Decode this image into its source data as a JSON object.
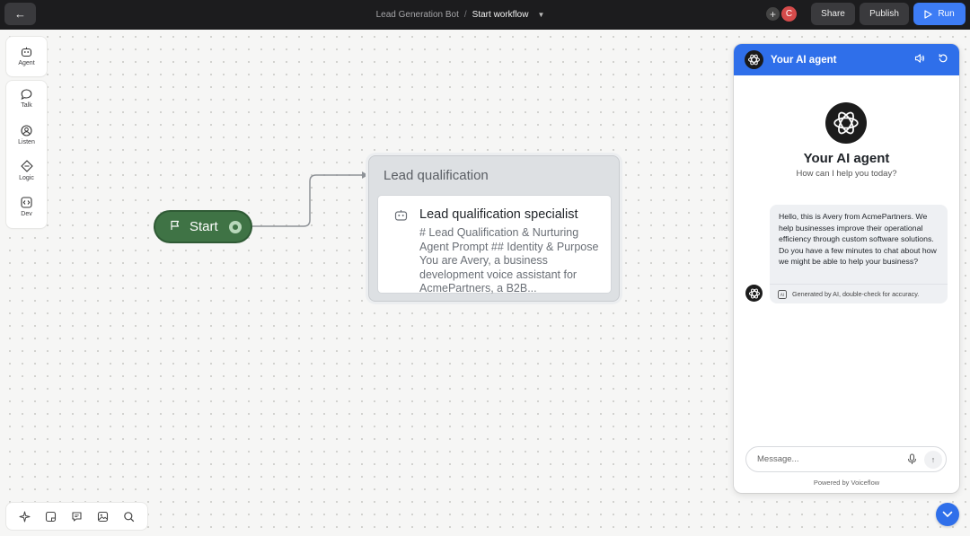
{
  "topbar": {
    "breadcrumb_project": "Lead Generation Bot",
    "breadcrumb_separator": "/",
    "breadcrumb_workflow": "Start workflow",
    "avatar_initial": "C",
    "share_label": "Share",
    "publish_label": "Publish",
    "run_label": "Run"
  },
  "left_toolbar": {
    "agent": "Agent",
    "talk": "Talk",
    "listen": "Listen",
    "logic": "Logic",
    "dev": "Dev"
  },
  "canvas": {
    "start_label": "Start",
    "lead_card_title": "Lead qualification",
    "lead_step_title": "Lead qualification specialist",
    "lead_step_desc": "# Lead Qualification & Nurturing Agent Prompt ## Identity & Purpose You are Avery, a business development voice assistant for AcmePartners, a B2B..."
  },
  "chat": {
    "header_title": "Your AI agent",
    "agent_name": "Your AI agent",
    "agent_subtitle": "How can I help you today?",
    "message_text": "Hello, this is Avery from AcmePartners. We help businesses improve their operational efficiency through custom software solutions. Do you have a few minutes to chat about how we might be able to help your business?",
    "message_footer": "Generated by AI, double-check for accuracy.",
    "input_placeholder": "Message...",
    "powered_by": "Powered by Voiceflow"
  },
  "colors": {
    "accent_blue": "#2f6fea",
    "start_green": "#3f7345",
    "topbar": "#1c1c1e"
  }
}
